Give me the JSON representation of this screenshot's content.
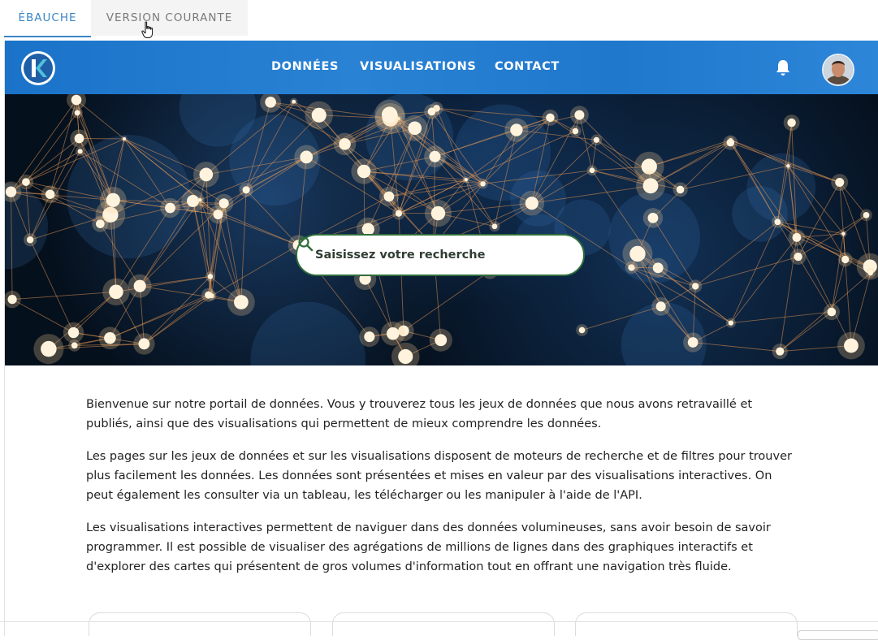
{
  "tabs": [
    {
      "label": "ÉBAUCHE",
      "active": true
    },
    {
      "label": "VERSION COURANTE",
      "active": false
    }
  ],
  "navbar": {
    "logo_letter": "K",
    "links": [
      "DONNÉES",
      "VISUALISATIONS",
      "CONTACT"
    ],
    "bell_icon": "bell-icon",
    "avatar_icon": "user-avatar"
  },
  "hero": {
    "search": {
      "placeholder": "Saisissez votre recherche",
      "icon": "search-icon"
    }
  },
  "content": {
    "paragraphs": [
      "Bienvenue sur notre portail de données. Vous y trouverez tous les jeux de données que nous avons retravaillé et publiés, ainsi que des visualisations qui permettent de mieux comprendre les données.",
      "Les pages sur les jeux de données et sur les visualisations disposent de moteurs de recherche et de filtres pour trouver plus facilement les données. Les données sont présentées et mises en valeur par des visualisations interactives. On peut également les consulter via un tableau, les télécharger ou les manipuler à l'aide de l'API.",
      "Les visualisations interactives permettent de naviguer dans des données volumineuses, sans avoir besoin de savoir programmer. Il est possible de visualiser des agrégations de millions de lignes dans des graphiques interactifs et d'explorer des cartes qui présentent de gros volumes d'information tout en offrant une navigation très fluide."
    ]
  },
  "colors": {
    "tab_active": "#3a86c4",
    "navbar": "#1f78cc",
    "search_border": "#2e6e3a"
  }
}
